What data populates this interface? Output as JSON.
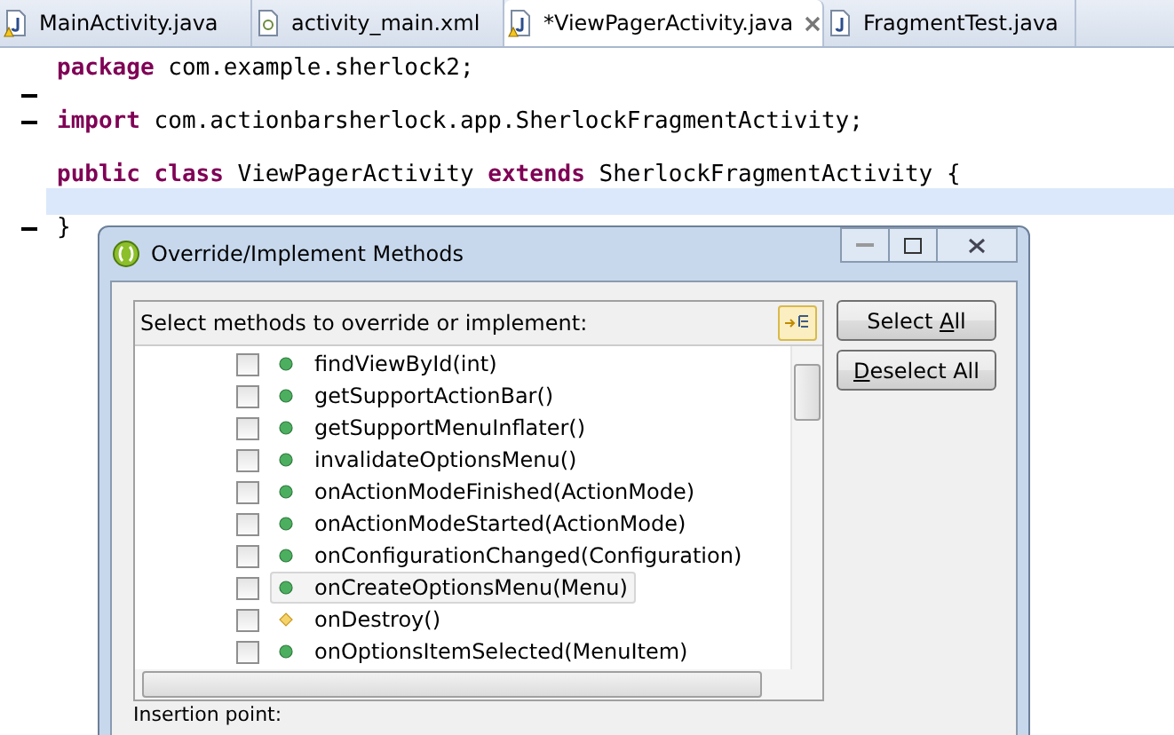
{
  "tabs": [
    {
      "label": "MainActivity.java",
      "kind": "java",
      "warning": true,
      "selected": false
    },
    {
      "label": "activity_main.xml",
      "kind": "xml",
      "warning": false,
      "selected": false
    },
    {
      "label": "*ViewPagerActivity.java",
      "kind": "java",
      "warning": true,
      "selected": true
    },
    {
      "label": "FragmentTest.java",
      "kind": "java",
      "warning": false,
      "selected": false
    }
  ],
  "code": [
    {
      "kind": "code",
      "marker": false,
      "current": false,
      "tokens": [
        {
          "text": "package",
          "kind": "keyword"
        },
        {
          "text": "com.example.sherlock2;",
          "kind": "plain"
        }
      ]
    },
    {
      "kind": "blank",
      "marker": true,
      "current": false
    },
    {
      "kind": "code",
      "marker": true,
      "current": false,
      "tokens": [
        {
          "text": "import",
          "kind": "keyword"
        },
        {
          "text": "com.actionbarsherlock.app.SherlockFragmentActivity;",
          "kind": "plain"
        }
      ]
    },
    {
      "kind": "blank",
      "marker": false,
      "current": false
    },
    {
      "kind": "code",
      "marker": false,
      "current": false,
      "tokens": [
        {
          "text": "public",
          "kind": "keyword"
        },
        {
          "text": "class",
          "kind": "keyword"
        },
        {
          "text": "ViewPagerActivity",
          "kind": "plain"
        },
        {
          "text": "extends",
          "kind": "keyword"
        },
        {
          "text": "SherlockFragmentActivity {",
          "kind": "plain"
        }
      ]
    },
    {
      "kind": "blank",
      "marker": false,
      "current": true
    },
    {
      "kind": "code",
      "marker": true,
      "current": false,
      "tokens": [
        {
          "text": "}",
          "kind": "plain"
        }
      ]
    }
  ],
  "dialog": {
    "title": "Override/Implement Methods",
    "prompt": "Select methods to override or implement:",
    "methods": [
      {
        "name": "findViewById(int)",
        "kind": "public",
        "checked": false,
        "selected": false
      },
      {
        "name": "getSupportActionBar()",
        "kind": "public",
        "checked": false,
        "selected": false
      },
      {
        "name": "getSupportMenuInflater()",
        "kind": "public",
        "checked": false,
        "selected": false
      },
      {
        "name": "invalidateOptionsMenu()",
        "kind": "public",
        "checked": false,
        "selected": false
      },
      {
        "name": "onActionModeFinished(ActionMode)",
        "kind": "public",
        "checked": false,
        "selected": false
      },
      {
        "name": "onActionModeStarted(ActionMode)",
        "kind": "public",
        "checked": false,
        "selected": false
      },
      {
        "name": "onConfigurationChanged(Configuration)",
        "kind": "public",
        "checked": false,
        "selected": false
      },
      {
        "name": "onCreateOptionsMenu(Menu)",
        "kind": "public",
        "checked": false,
        "selected": true
      },
      {
        "name": "onDestroy()",
        "kind": "protected",
        "checked": false,
        "selected": false
      },
      {
        "name": "onOptionsItemSelected(MenuItem)",
        "kind": "public",
        "checked": false,
        "selected": false
      }
    ],
    "buttons": [
      {
        "before": "Select ",
        "key": "A",
        "after": "ll"
      },
      {
        "key": "D",
        "after": "eselect All"
      }
    ],
    "insertion_label": "Insertion point:"
  }
}
